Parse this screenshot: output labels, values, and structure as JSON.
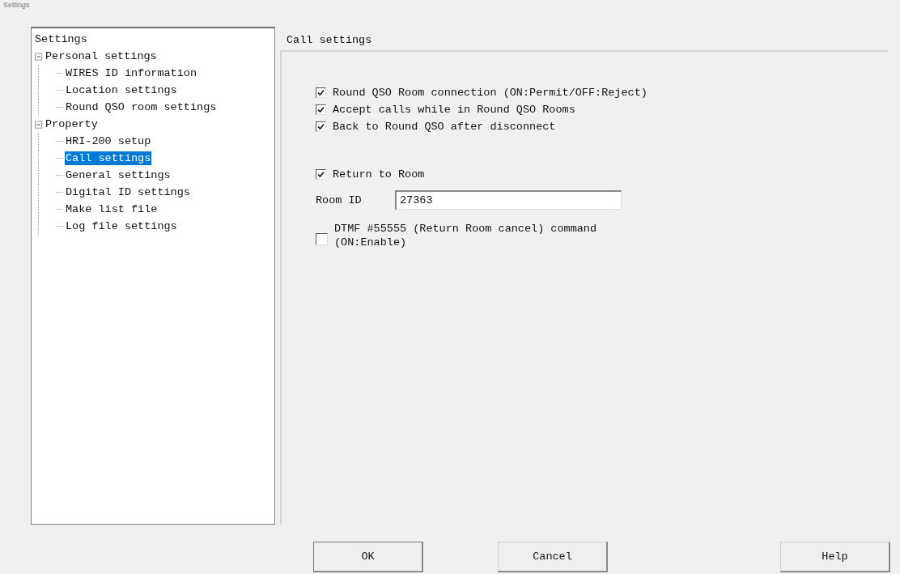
{
  "window": {
    "title": "Settings"
  },
  "tree": {
    "label": "Settings",
    "selected": false,
    "children": [
      {
        "label": "Personal settings",
        "expanded": true,
        "selected": false,
        "children": [
          {
            "label": "WIRES ID information",
            "selected": false
          },
          {
            "label": "Location settings",
            "selected": false
          },
          {
            "label": "Round QSO room settings",
            "selected": false
          }
        ]
      },
      {
        "label": "Property",
        "expanded": true,
        "selected": false,
        "children": [
          {
            "label": "HRI-200 setup",
            "selected": false
          },
          {
            "label": "Call settings",
            "selected": true
          },
          {
            "label": "General settings",
            "selected": false
          },
          {
            "label": "Digital ID settings",
            "selected": false
          },
          {
            "label": "Make list file",
            "selected": false
          },
          {
            "label": "Log file settings",
            "selected": false
          }
        ]
      }
    ]
  },
  "panel": {
    "title": "Call settings",
    "group1": [
      {
        "label": "Round QSO Room connection (ON:Permit/OFF:Reject)",
        "checked": true
      },
      {
        "label": "Accept calls while in Round QSO Rooms",
        "checked": true
      },
      {
        "label": "Back to Round QSO after disconnect",
        "checked": true
      }
    ],
    "return_to_room": {
      "label": "Return to Room",
      "checked": true
    },
    "room_id": {
      "label": "Room ID",
      "value": "27363"
    },
    "dtmf": {
      "label": "DTMF #55555 (Return Room cancel) command",
      "label_line2": "(ON:Enable)",
      "checked": false
    }
  },
  "buttons": [
    "OK",
    "Cancel",
    "Help"
  ]
}
